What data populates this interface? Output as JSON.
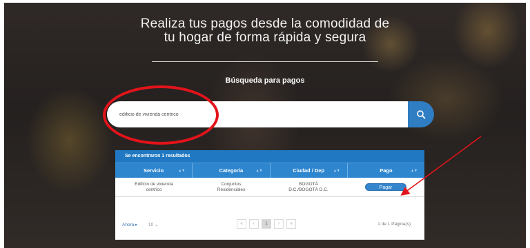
{
  "hero": {
    "headline_line1": "Realiza tus pagos desde la comodidad de",
    "headline_line2": "tu hogar de forma rápida y segura",
    "search_title": "Búsqueda para pagos"
  },
  "search": {
    "value": "edificio de vivienda centrico",
    "button_icon": "search-icon"
  },
  "results": {
    "summary": "Se encontraron 1 resultados",
    "columns": [
      "Servicio",
      "Categoría",
      "Ciudad / Dep",
      "Pago"
    ],
    "rows": [
      {
        "servicio_line1": "Edificio de vivienda",
        "servicio_line2": "centrico",
        "categoria_line1": "Conjuntos",
        "categoria_line2": "Residenciales",
        "ciudad_line1": "BOGOTÁ",
        "ciudad_line2": "D.C./BOGOTÁ D.C.",
        "pago_label": "Pagar"
      }
    ]
  },
  "pager": {
    "rows_label": "Ahora ▸",
    "rows_value": "10",
    "first": "«",
    "prev": "‹",
    "page": "1",
    "next": "›",
    "last": "»",
    "info": "1 de 1 Página(s)"
  },
  "annotations": {
    "ellipse_color": "#e2131a",
    "arrow_color": "#e2131a"
  }
}
